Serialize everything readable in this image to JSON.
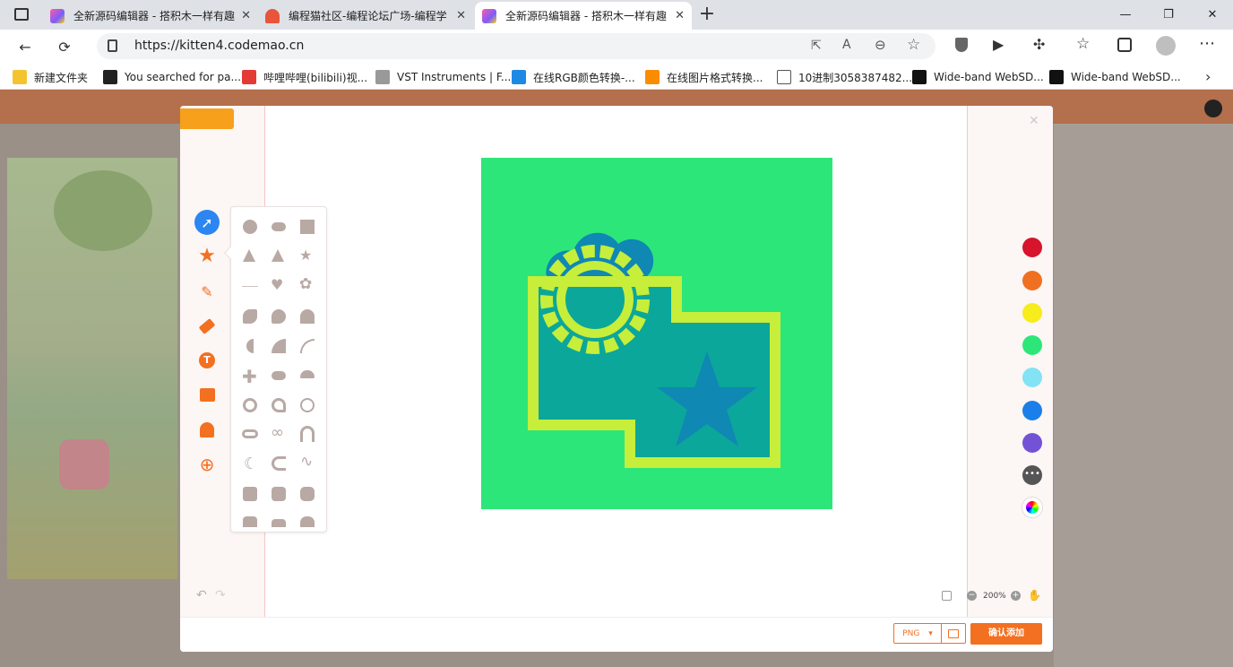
{
  "browser": {
    "tabs": [
      {
        "title": "全新源码编辑器 - 搭积木一样有趣",
        "active": false
      },
      {
        "title": "编程猫社区-编程论坛广场-编程学",
        "active": false
      },
      {
        "title": "全新源码编辑器 - 搭积木一样有趣",
        "active": true
      }
    ],
    "new_tab": "+",
    "url": "https://kitten4.codemao.cn",
    "bookmarks": [
      {
        "label": "新建文件夹",
        "color": "#f4c430"
      },
      {
        "label": "You searched for pa...",
        "color": "#222222"
      },
      {
        "label": "哔哩哔哩(bilibili)视...",
        "color": "#e53935"
      },
      {
        "label": "VST Instruments | F...",
        "color": "#888888"
      },
      {
        "label": "在线RGB颜色转换-...",
        "color": "#1e88e5"
      },
      {
        "label": "在线图片格式转换...",
        "color": "#fb8c00"
      },
      {
        "label": "10进制3058387482...",
        "color": "#ffffff"
      },
      {
        "label": "Wide-band WebSD...",
        "color": "#111111"
      },
      {
        "label": "Wide-band WebSD...",
        "color": "#111111"
      }
    ]
  },
  "editor": {
    "tools": [
      "select-icon",
      "shape-icon",
      "pencil-icon",
      "eraser-icon",
      "text-icon",
      "image-icon",
      "ghost-icon",
      "target-icon"
    ],
    "palette": [
      "#d7142c",
      "#f07021",
      "#f7ec1c",
      "#2de67a",
      "#84e2f5",
      "#1a7fe8",
      "#7452d6",
      "#555555"
    ],
    "zoom": "200%",
    "format": "PNG",
    "confirm_label": "确认添加",
    "canvas_colors": {
      "bg": "#2de67a",
      "fill": "#0ba79a",
      "outline": "#c6ee3a",
      "star": "#0f88b4",
      "cloud": "#0f88b4"
    }
  }
}
